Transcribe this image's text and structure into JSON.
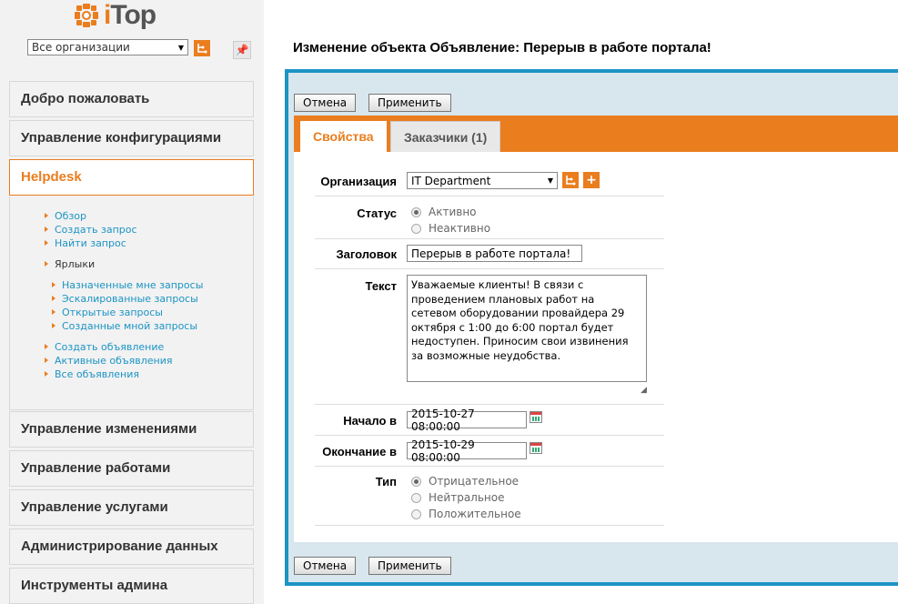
{
  "app": {
    "logo_text_prefix": "i",
    "logo_text_suffix": "Top"
  },
  "sidebar": {
    "org_select_value": "Все организации",
    "groups": [
      {
        "label": "Добро пожаловать"
      },
      {
        "label": "Управление конфигурациями"
      },
      {
        "label": "Helpdesk"
      },
      {
        "label": "Управление изменениями"
      },
      {
        "label": "Управление работами"
      },
      {
        "label": "Управление услугами"
      },
      {
        "label": "Администрирование данных"
      },
      {
        "label": "Инструменты админа"
      }
    ],
    "helpdesk_items": [
      {
        "label": "Обзор"
      },
      {
        "label": "Создать запрос"
      },
      {
        "label": "Найти запрос"
      },
      {
        "label": "Ярлыки"
      },
      {
        "label": "Назначенные мне запросы"
      },
      {
        "label": "Эскалированные запросы"
      },
      {
        "label": "Открытые запросы"
      },
      {
        "label": "Созданные мной запросы"
      },
      {
        "label": "Создать объявление"
      },
      {
        "label": "Активные объявления"
      },
      {
        "label": "Все объявления"
      }
    ]
  },
  "page": {
    "title": "Изменение объекта Объявление: Перерыв в работе портала!"
  },
  "toolbar": {
    "cancel_label": "Отмена",
    "apply_label": "Применить"
  },
  "tabs": [
    {
      "label": "Свойства"
    },
    {
      "label": "Заказчики (1)"
    }
  ],
  "form": {
    "org_label": "Организация",
    "org_value": "IT Department",
    "status_label": "Статус",
    "status_options": [
      "Активно",
      "Неактивно"
    ],
    "status_selected": "Активно",
    "title_label": "Заголовок",
    "title_value": "Перерыв в работе портала!",
    "text_label": "Текст",
    "text_value": "Уважаемые клиенты! В связи с проведением плановых работ на сетевом оборудовании провайдера 29 октября с 1:00 до 6:00 портал будет недоступен. Приносим свои извинения за возможные неудобства.",
    "start_label": "Начало в",
    "start_value": "2015-10-27 08:00:00",
    "end_label": "Окончание в",
    "end_value": "2015-10-29 08:00:00",
    "type_label": "Тип",
    "type_options": [
      "Отрицательное",
      "Нейтральное",
      "Положительное"
    ],
    "type_selected": "Отрицательное"
  },
  "colors": {
    "accent": "#ea7d1e",
    "frame": "#1c94c4",
    "link": "#1c94c4"
  }
}
